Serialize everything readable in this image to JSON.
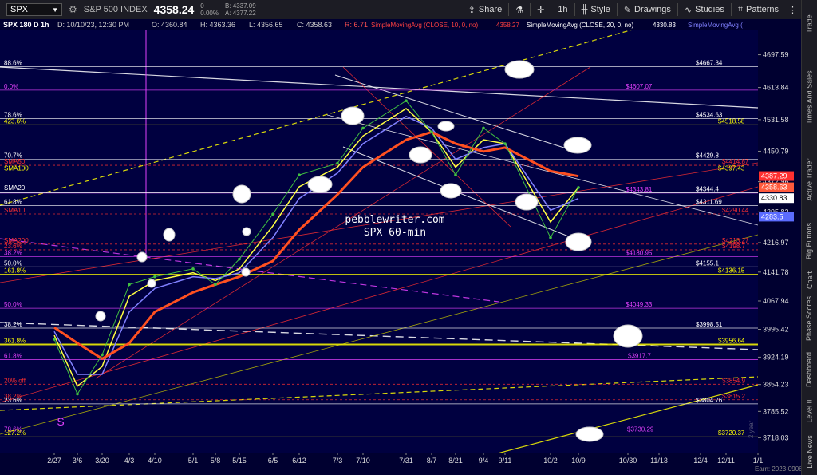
{
  "toolbar": {
    "symbol": "SPX",
    "name": "S&P 500 INDEX",
    "last": "4358.24",
    "change": "0",
    "change_pct": "0.00%",
    "bid": "B: 4337.09",
    "ask": "A: 4377.22",
    "share": "Share",
    "timeframe": "1h",
    "style": "Style",
    "drawings": "Drawings",
    "studies": "Studies",
    "patterns": "Patterns"
  },
  "info_bar": {
    "title": "SPX 180 D 1h",
    "date": "D: 10/10/23, 12:30 PM",
    "open": "O: 4360.84",
    "high": "H: 4363.36",
    "low": "L: 4356.65",
    "close": "C: 4358.63",
    "range": "R: 6.71",
    "study1": "SimpleMovingAvg (CLOSE, 10, 0, no)",
    "study1_value": "4358.27",
    "study2": "SimpleMovingAvg (CLOSE, 20, 0, no)",
    "study2_value": "4330.83",
    "study3": "SimpleMovingAvg ("
  },
  "right_nav": [
    "Trade",
    "Times And Sales",
    "Active Trader",
    "Big Buttons",
    "Chart",
    "Phase Scores",
    "Dashboard",
    "Level II",
    "Live News"
  ],
  "watermark": {
    "line1": "pebblewriter.com",
    "line2": "SPX 60-min"
  },
  "marker_s": "S",
  "corner_note": "2 year",
  "status": "Earn: 2023-0906",
  "chart_data": {
    "type": "line",
    "ylim": [
      3680,
      4760
    ],
    "y_ticks": [
      4697.59,
      4613.84,
      4531.58,
      4450.79,
      4372.96,
      4295.82,
      4216.97,
      4141.78,
      4067.94,
      3995.42,
      3924.19,
      3854.23,
      3785.52,
      3718.03
    ],
    "x_ticks": [
      "2/27",
      "3/6",
      "3/20",
      "4/3",
      "4/10",
      "5/1",
      "5/8",
      "5/15",
      "6/5",
      "6/12",
      "7/3",
      "7/10",
      "7/31",
      "8/7",
      "8/21",
      "9/4",
      "9/11",
      "10/2",
      "10/9",
      "10/30",
      "11/13",
      "12/4",
      "12/11",
      "1/1"
    ],
    "horizontal_levels": [
      {
        "label": "$4667.34",
        "value": 4667.34,
        "color": "#ffffff"
      },
      {
        "label": "$4607.07",
        "value": 4607.07,
        "color": "#e040fb"
      },
      {
        "label": "$4534.63",
        "value": 4534.63,
        "color": "#ffffff"
      },
      {
        "label": "$4518.58",
        "value": 4518.58,
        "color": "#ffff00"
      },
      {
        "label": "$4429.8",
        "value": 4429.8,
        "color": "#ffffff"
      },
      {
        "label": "$4414.87",
        "value": 4414.87,
        "color": "#ff3030"
      },
      {
        "label": "$4397.43",
        "value": 4397.43,
        "color": "#ffff00"
      },
      {
        "label": "$4343.81",
        "value": 4343.81,
        "color": "#e040fb"
      },
      {
        "label": "$4344.4",
        "value": 4344.4,
        "color": "#ffffff"
      },
      {
        "label": "$4311.69",
        "value": 4311.69,
        "color": "#ffffff"
      },
      {
        "label": "$4290.44",
        "value": 4290.44,
        "color": "#ff3030"
      },
      {
        "label": "$4213.27",
        "value": 4213.27,
        "color": "#ff3030"
      },
      {
        "label": "$4198.7",
        "value": 4198.7,
        "color": "#ff3030"
      },
      {
        "label": "$4180.95",
        "value": 4180.95,
        "color": "#e040fb"
      },
      {
        "label": "$4155.1",
        "value": 4155.1,
        "color": "#ffffff"
      },
      {
        "label": "$4136.15",
        "value": 4136.15,
        "color": "#ffff00"
      },
      {
        "label": "$4049.33",
        "value": 4049.33,
        "color": "#e040fb"
      },
      {
        "label": "$3998.51",
        "value": 3998.51,
        "color": "#ffffff"
      },
      {
        "label": "$3956.64",
        "value": 3956.64,
        "color": "#ffff00"
      },
      {
        "label": "$3917.7",
        "value": 3917.7,
        "color": "#e040fb"
      },
      {
        "label": "$3854.9",
        "value": 3854.9,
        "color": "#ff3030"
      },
      {
        "label": "$3815.2",
        "value": 3815.2,
        "color": "#ff3030"
      },
      {
        "label": "$3804.76",
        "value": 3804.76,
        "color": "#ffffff"
      },
      {
        "label": "$3730.29",
        "value": 3730.29,
        "color": "#e040fb"
      },
      {
        "label": "$3720.37",
        "value": 3720.37,
        "color": "#ffff00"
      }
    ],
    "left_labels": [
      {
        "label": "88.6%",
        "value": 4667.34,
        "color": "#ffffff"
      },
      {
        "label": "0.0%",
        "value": 4607.07,
        "color": "#e040fb"
      },
      {
        "label": "78.6%",
        "value": 4534.63,
        "color": "#ffffff"
      },
      {
        "label": "423.6%",
        "value": 4518.58,
        "color": "#ffff00"
      },
      {
        "label": "70.7%",
        "value": 4429.8,
        "color": "#ffffff"
      },
      {
        "label": "SMA50",
        "value": 4414.87,
        "color": "#ff3030"
      },
      {
        "label": "SMA100",
        "value": 4397.43,
        "color": "#ffff00"
      },
      {
        "label": "SMA20",
        "value": 4348.0,
        "color": "#ffffff"
      },
      {
        "label": "61.8%",
        "value": 4311.69,
        "color": "#ffffff"
      },
      {
        "label": "SMA10",
        "value": 4290.44,
        "color": "#ff3030"
      },
      {
        "label": "SMA200",
        "value": 4213.27,
        "color": "#ff3030"
      },
      {
        "label": "23.6%",
        "value": 4198.7,
        "color": "#ff3030"
      },
      {
        "label": "38.2%",
        "value": 4180.95,
        "color": "#e040fb"
      },
      {
        "label": "50.0%",
        "value": 4155.1,
        "color": "#ffffff"
      },
      {
        "label": "161.8%",
        "value": 4136.15,
        "color": "#ffff00"
      },
      {
        "label": "50.0%",
        "value": 4049.33,
        "color": "#e040fb"
      },
      {
        "label": "38.2%",
        "value": 3998.51,
        "color": "#ffffff"
      },
      {
        "label": "361.8%",
        "value": 3956.64,
        "color": "#ffff00"
      },
      {
        "label": "61.8%",
        "value": 3917.7,
        "color": "#e040fb"
      },
      {
        "label": "20% off",
        "value": 3854.9,
        "color": "#ff3030"
      },
      {
        "label": "38.2%",
        "value": 3815.2,
        "color": "#ff3030"
      },
      {
        "label": "23.6%",
        "value": 3804.76,
        "color": "#ffffff"
      },
      {
        "label": "78.6%",
        "value": 3730.29,
        "color": "#e040fb"
      },
      {
        "label": "127.2%",
        "value": 3720.37,
        "color": "#ffff00"
      }
    ],
    "price_badges": [
      {
        "label": "4387.29",
        "value": 4387.29,
        "color": "#ff3030"
      },
      {
        "label": "4358.63",
        "value": 4358.63,
        "color": "#ff5a3c"
      },
      {
        "label": "4330.83",
        "value": 4330.83,
        "color": "#ffffff"
      },
      {
        "label": "4283.5",
        "value": 4283.5,
        "color": "#5b6cff"
      }
    ],
    "price_series": {
      "name": "SPX",
      "x": [
        "2/27",
        "3/6",
        "3/20",
        "4/3",
        "4/10",
        "5/1",
        "5/8",
        "5/15",
        "6/5",
        "6/12",
        "7/3",
        "7/10",
        "7/31",
        "8/7",
        "8/21",
        "9/4",
        "9/11",
        "10/2",
        "10/9"
      ],
      "values": [
        3970,
        3830,
        3930,
        4110,
        4130,
        4150,
        4110,
        4175,
        4290,
        4390,
        4420,
        4510,
        4580,
        4500,
        4390,
        4510,
        4470,
        4230,
        4358
      ]
    },
    "moving_averages": [
      {
        "name": "SimpleMovingAvg (CLOSE, 10, 0, no)",
        "color": "#ffff40",
        "values": [
          3980,
          3850,
          3900,
          4080,
          4120,
          4140,
          4120,
          4150,
          4260,
          4360,
          4410,
          4490,
          4560,
          4500,
          4410,
          4480,
          4470,
          4270,
          4358
        ]
      },
      {
        "name": "SimpleMovingAvg (CLOSE, 20, 0, no)",
        "color": "#8080ff",
        "values": [
          3990,
          3880,
          3880,
          4040,
          4100,
          4130,
          4125,
          4140,
          4230,
          4330,
          4395,
          4470,
          4540,
          4510,
          4430,
          4460,
          4470,
          4300,
          4330
        ]
      },
      {
        "name": "SMA50",
        "color": "#ff5020",
        "values": [
          4000,
          3960,
          3920,
          3960,
          4040,
          4090,
          4110,
          4130,
          4170,
          4250,
          4340,
          4410,
          4480,
          4500,
          4470,
          4450,
          4460,
          4400,
          4387
        ]
      }
    ]
  }
}
